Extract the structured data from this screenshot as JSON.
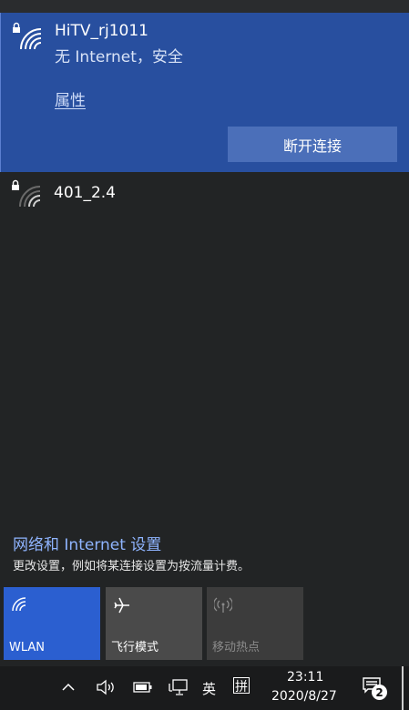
{
  "wifi": {
    "connected": {
      "ssid": "HiTV_rj1011",
      "status": "无 Internet，安全",
      "properties_label": "属性",
      "disconnect_label": "断开连接",
      "icon": "wifi-secured-icon"
    },
    "other_networks": [
      {
        "ssid": "401_2.4",
        "icon": "wifi-secured-icon"
      }
    ]
  },
  "settings": {
    "link_label": "网络和 Internet 设置",
    "description": "更改设置，例如将某连接设置为按流量计费。"
  },
  "quick_actions": [
    {
      "label": "WLAN",
      "state": "on",
      "icon": "wifi-icon"
    },
    {
      "label": "飞行模式",
      "state": "off",
      "icon": "airplane-icon"
    },
    {
      "label": "移动热点",
      "state": "disabled",
      "icon": "hotspot-icon"
    }
  ],
  "taskbar": {
    "ime_lang": "英",
    "ime_mode": "拼",
    "time": "23:11",
    "date": "2020/8/27",
    "notification_count": "2"
  },
  "colors": {
    "flyout_bg": "#222425",
    "connected_bg": "#284f9f",
    "accent": "#2b5fd0",
    "link": "#8fb4ff"
  }
}
